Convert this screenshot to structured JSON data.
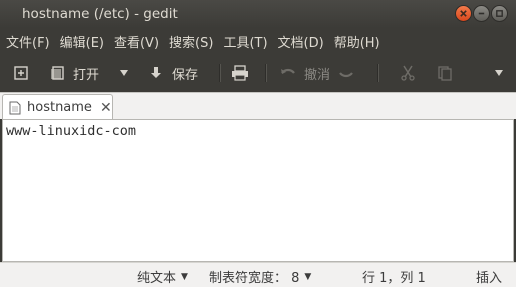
{
  "window": {
    "title": "hostname (/etc) - gedit"
  },
  "menu": {
    "items": [
      "文件(F)",
      "编辑(E)",
      "查看(V)",
      "搜索(S)",
      "工具(T)",
      "文档(D)",
      "帮助(H)"
    ]
  },
  "toolbar": {
    "open_label": "打开",
    "save_label": "保存",
    "undo_label": "撤消"
  },
  "tabs": [
    {
      "label": "hostname",
      "close": "✕"
    }
  ],
  "editor": {
    "content": "www-linuxidc-com"
  },
  "statusbar": {
    "language": "纯文本",
    "tab_width": "制表符宽度： 8",
    "position": "行 1，列 1",
    "mode": "插入"
  },
  "colors": {
    "chrome": "#3c3b37",
    "close_button": "#e35a2a"
  }
}
